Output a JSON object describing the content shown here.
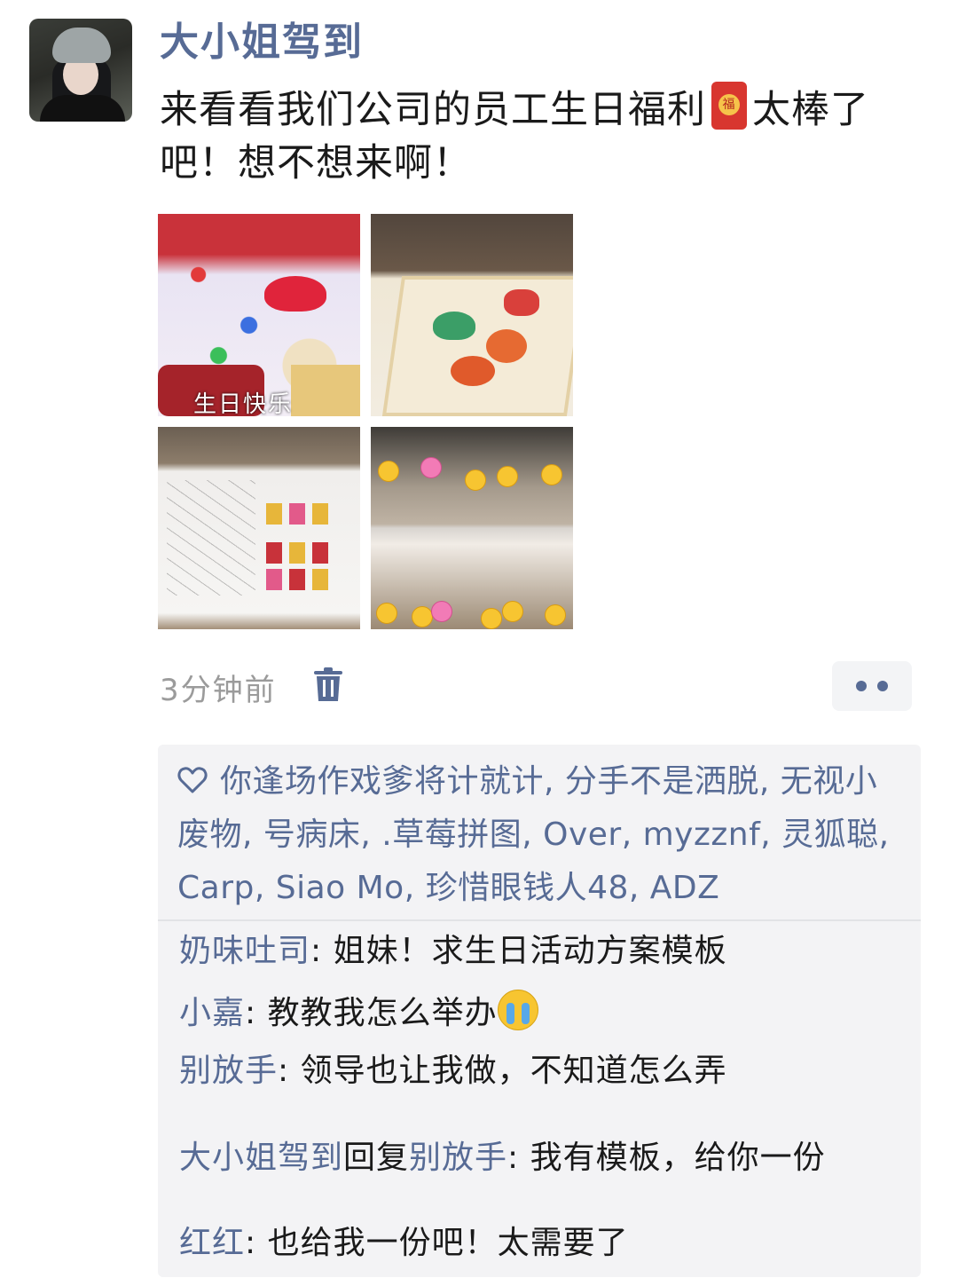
{
  "post": {
    "username": "大小姐驾到",
    "text_before_emoji": "来看看我们公司的员工生日福利",
    "emoji_icon": "red-envelope-icon",
    "emoji_glyph": "福",
    "text_after_emoji": "太棒了吧！想不想来啊！",
    "photo_caption": "生日快乐",
    "timestamp": "3分钟前"
  },
  "likes": {
    "names": "你逢场作戏爹将计就计, 分手不是洒脱, 无视小废物, 号病床, .草莓拼图, Over, myzznf, 灵狐聪, Carp, Siao Mo, 珍惜眼钱人48, ADZ"
  },
  "comments": [
    {
      "nick": "奶味吐司",
      "sep": ": ",
      "text": "姐妹！求生日活动方案模板"
    },
    {
      "nick": "小嘉",
      "sep": ": ",
      "text": "教教我怎么举办"
    },
    {
      "nick": "别放手",
      "sep": ": ",
      "text": "领导也让我做，不知道怎么弄"
    },
    {
      "nick": "大小姐驾到",
      "reply_word": "回复",
      "reply_to": "别放手",
      "sep": ": ",
      "text": "我有模板，给你一份"
    },
    {
      "nick": "红红",
      "sep": ": ",
      "text": "也给我一份吧！太需要了"
    }
  ],
  "colors": {
    "link": "#576b95",
    "text": "#1a1a1a",
    "meta": "#9b9b9b",
    "comment_bg": "#f3f3f5"
  }
}
